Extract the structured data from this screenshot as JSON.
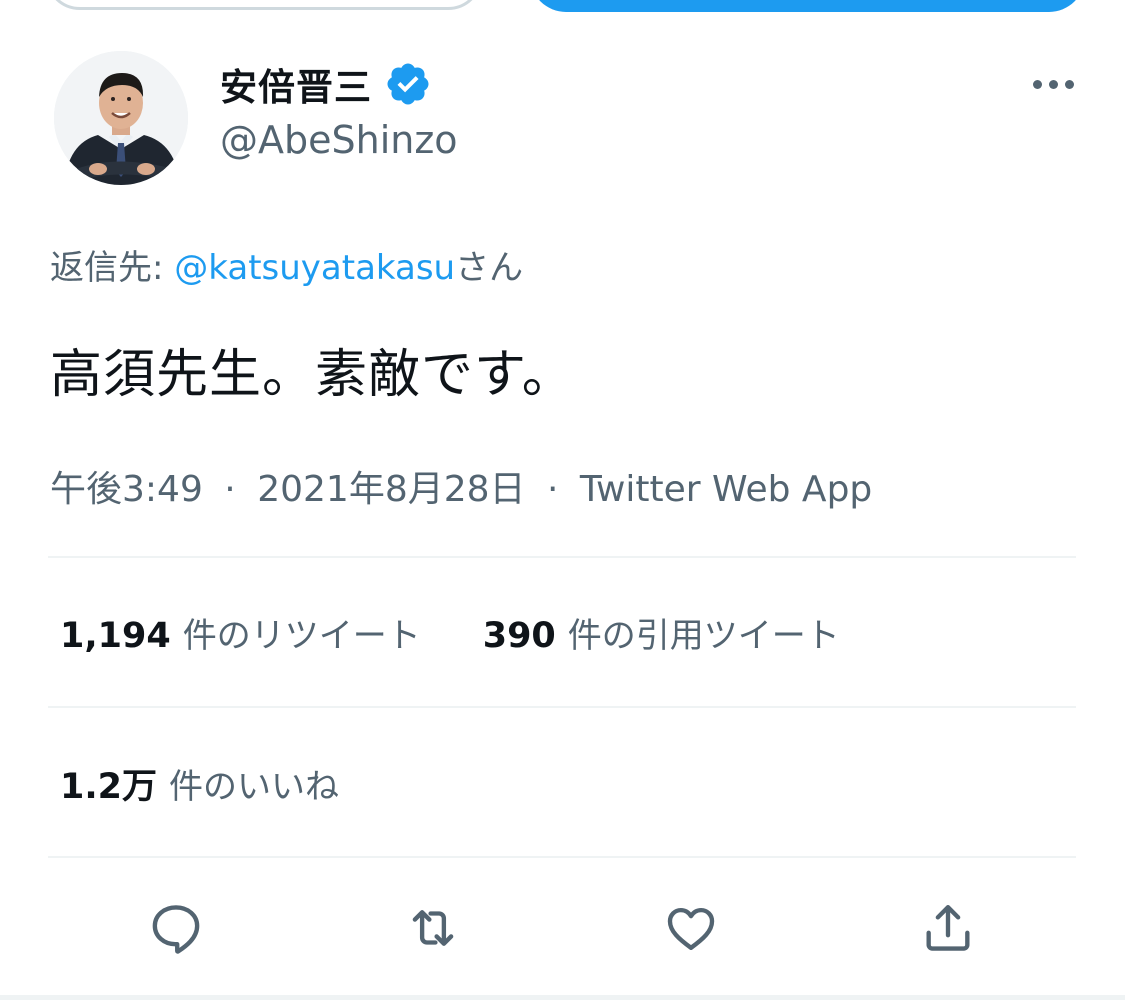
{
  "author": {
    "display_name": "安倍晋三",
    "handle": "@AbeShinzo",
    "verified": true
  },
  "reply": {
    "prefix": "返信先: ",
    "mention": "@katsuyatakasu",
    "suffix": "さん"
  },
  "tweet": {
    "text": "高須先生。素敵です。"
  },
  "meta": {
    "time": "午後3:49",
    "separator": "·",
    "date": "2021年8月28日",
    "source": "Twitter Web App"
  },
  "stats": {
    "retweets_count": "1,194",
    "retweets_label": "件のリツイート",
    "quotes_count": "390",
    "quotes_label": "件の引用ツイート",
    "likes_count": "1.2万",
    "likes_label": "件のいいね"
  },
  "icons": {
    "more": "more-horizontal-icon",
    "verified": "verified-badge-icon",
    "reply": "reply-icon",
    "retweet": "retweet-icon",
    "like": "like-icon",
    "share": "share-icon"
  },
  "colors": {
    "accent": "#1d9bf0",
    "text_primary": "#0f1419",
    "text_secondary": "#536471",
    "divider": "#eff3f4"
  }
}
